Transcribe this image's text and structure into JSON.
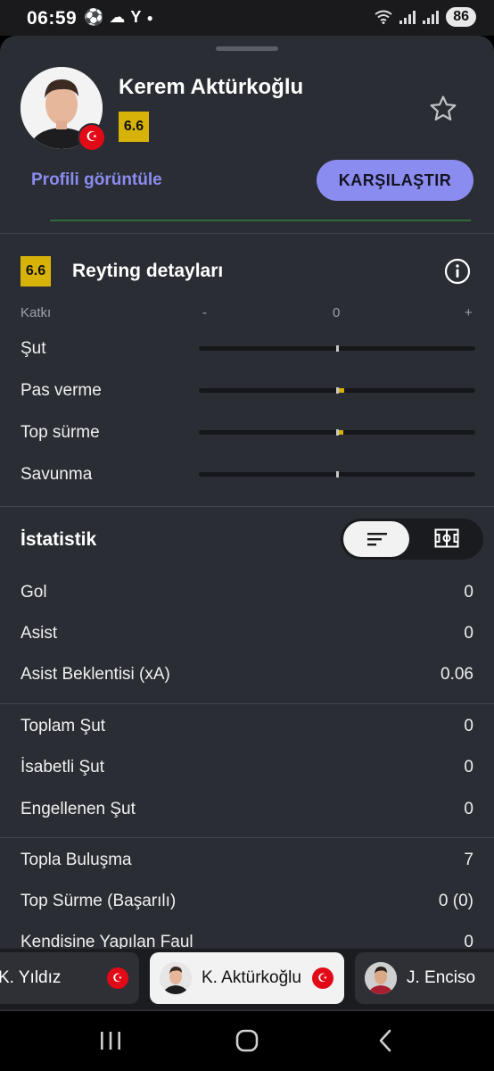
{
  "status_bar": {
    "time": "06:59",
    "battery": "86"
  },
  "player": {
    "name": "Kerem Aktürkoğlu",
    "rating": "6.6"
  },
  "actions": {
    "profile_link": "Profili görüntüle",
    "compare_button": "KARŞILAŞTIR"
  },
  "rating_details": {
    "badge": "6.6",
    "title": "Reyting detayları",
    "scale": {
      "label": "Katkı",
      "minus": "-",
      "zero": "0",
      "plus": "+"
    },
    "rows": [
      {
        "label": "Şut",
        "contribution": 0
      },
      {
        "label": "Pas verme",
        "contribution": 0.04
      },
      {
        "label": "Top sürme",
        "contribution": 0.03
      },
      {
        "label": "Savunma",
        "contribution": 0
      }
    ]
  },
  "stats": {
    "title": "İstatistik",
    "groups": [
      [
        {
          "label": "Gol",
          "value": "0"
        },
        {
          "label": "Asist",
          "value": "0"
        },
        {
          "label": "Asist Beklentisi (xA)",
          "value": "0.06"
        }
      ],
      [
        {
          "label": "Toplam Şut",
          "value": "0"
        },
        {
          "label": "İsabetli Şut",
          "value": "0"
        },
        {
          "label": "Engellenen Şut",
          "value": "0"
        }
      ],
      [
        {
          "label": "Topla Buluşma",
          "value": "7"
        },
        {
          "label": "Top Sürme (Başarılı)",
          "value": "0 (0)"
        },
        {
          "label": "Kendisine Yapılan Faul",
          "value": "0"
        }
      ]
    ]
  },
  "player_chips": [
    {
      "name": "K. Yıldız"
    },
    {
      "name": "K. Aktürkoğlu"
    },
    {
      "name": "J. Enciso"
    }
  ],
  "colors": {
    "accent": "#8b8cf0",
    "rating": "#d7b30a",
    "sheet": "#2a2d33"
  }
}
